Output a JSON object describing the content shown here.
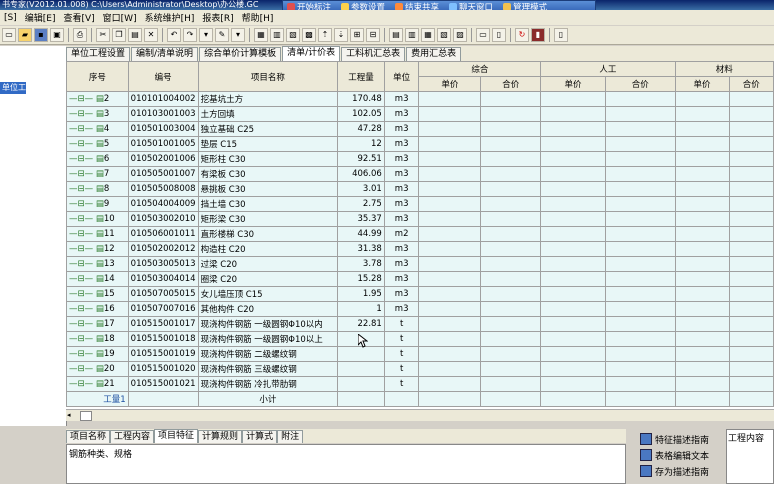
{
  "window": {
    "title": "书专家(V2012.01.008) C:\\Users\\Administrator\\Desktop\\办公楼.GC"
  },
  "floatbar": {
    "items": [
      {
        "label": "开始标注",
        "color": "#e05050"
      },
      {
        "label": "参数设置",
        "color": "#ffd24a"
      },
      {
        "label": "结束共享",
        "color": "#ff8a3a"
      },
      {
        "label": "聊天窗口",
        "color": "#7fc0ff"
      },
      {
        "label": "管理模式",
        "color": "#f2c14e"
      }
    ]
  },
  "menu": {
    "items": [
      "[S]",
      "编辑[E]",
      "查看[V]",
      "窗口[W]",
      "系统维护[H]",
      "报表[R]",
      "帮助[H]"
    ]
  },
  "left_panel": {
    "selected": "单位工程"
  },
  "tabs": [
    {
      "label": "单位工程设置",
      "active": false
    },
    {
      "label": "编制/清单说明",
      "active": false
    },
    {
      "label": "综合单价计算模板",
      "active": false
    },
    {
      "label": "清单/计价表",
      "active": true
    },
    {
      "label": "工料机汇总表",
      "active": false
    },
    {
      "label": "费用汇总表",
      "active": false
    }
  ],
  "table": {
    "headers": {
      "seq": "序号",
      "code": "编号",
      "name": "项目名称",
      "qty": "工程量",
      "unit": "单位",
      "group_comprehensive": "综合",
      "group_labor": "人工",
      "group_material": "材料",
      "unit_price": "单价",
      "total_price": "合价"
    },
    "rows": [
      {
        "seq": "2",
        "code": "010101004002",
        "name": "挖基坑土方",
        "qty": "170.48",
        "unit": "m3"
      },
      {
        "seq": "3",
        "code": "010103001003",
        "name": "土方回填",
        "qty": "102.05",
        "unit": "m3"
      },
      {
        "seq": "4",
        "code": "010501003004",
        "name": "独立基础 C25",
        "qty": "47.28",
        "unit": "m3"
      },
      {
        "seq": "5",
        "code": "010501001005",
        "name": "垫层 C15",
        "qty": "12",
        "unit": "m3"
      },
      {
        "seq": "6",
        "code": "010502001006",
        "name": "矩形柱 C30",
        "qty": "92.51",
        "unit": "m3"
      },
      {
        "seq": "7",
        "code": "010505001007",
        "name": "有梁板 C30",
        "qty": "406.06",
        "unit": "m3"
      },
      {
        "seq": "8",
        "code": "010505008008",
        "name": "悬挑板 C30",
        "qty": "3.01",
        "unit": "m3"
      },
      {
        "seq": "9",
        "code": "010504004009",
        "name": "挡土墙 C30",
        "qty": "2.75",
        "unit": "m3"
      },
      {
        "seq": "10",
        "code": "010503002010",
        "name": "矩形梁 C30",
        "qty": "35.37",
        "unit": "m3"
      },
      {
        "seq": "11",
        "code": "010506001011",
        "name": "直形楼梯 C30",
        "qty": "44.99",
        "unit": "m2"
      },
      {
        "seq": "12",
        "code": "010502002012",
        "name": "构造柱 C20",
        "qty": "31.38",
        "unit": "m3"
      },
      {
        "seq": "13",
        "code": "010503005013",
        "name": "过梁 C20",
        "qty": "3.78",
        "unit": "m3"
      },
      {
        "seq": "14",
        "code": "010503004014",
        "name": "圈梁 C20",
        "qty": "15.28",
        "unit": "m3"
      },
      {
        "seq": "15",
        "code": "010507005015",
        "name": "女儿墙压顶 C15",
        "qty": "1.95",
        "unit": "m3"
      },
      {
        "seq": "16",
        "code": "010507007016",
        "name": "其他构件 C20",
        "qty": "1",
        "unit": "m3"
      },
      {
        "seq": "17",
        "code": "010515001017",
        "name": "现浇构件钢筋 一级圆钢Φ10以内",
        "qty": "22.81",
        "unit": "t"
      },
      {
        "seq": "18",
        "code": "010515001018",
        "name": "现浇构件钢筋 一级圆钢Φ10以上",
        "qty": "",
        "unit": "t"
      },
      {
        "seq": "19",
        "code": "010515001019",
        "name": "现浇构件钢筋 二级螺纹钢",
        "qty": "",
        "unit": "t"
      },
      {
        "seq": "20",
        "code": "010515001020",
        "name": "现浇构件钢筋 三级螺纹钢",
        "qty": "",
        "unit": "t"
      },
      {
        "seq": "21",
        "code": "010515001021",
        "name": "现浇构件钢筋 冷扎带肋钢",
        "qty": "",
        "unit": "t"
      }
    ],
    "subtotal": {
      "seq": "工量1",
      "name": "小计"
    }
  },
  "bottom_tabs": [
    {
      "label": "项目名称",
      "active": false
    },
    {
      "label": "工程内容",
      "active": false
    },
    {
      "label": "项目特征",
      "active": true
    },
    {
      "label": "计算规则",
      "active": false
    },
    {
      "label": "计算式",
      "active": false
    },
    {
      "label": "附注",
      "active": false
    }
  ],
  "bottom_text": "钢筋种类、规格",
  "bottom_buttons": [
    "特征描述指南",
    "表格编辑文本",
    "存为描述指南"
  ],
  "work_content_label": "工程内容"
}
